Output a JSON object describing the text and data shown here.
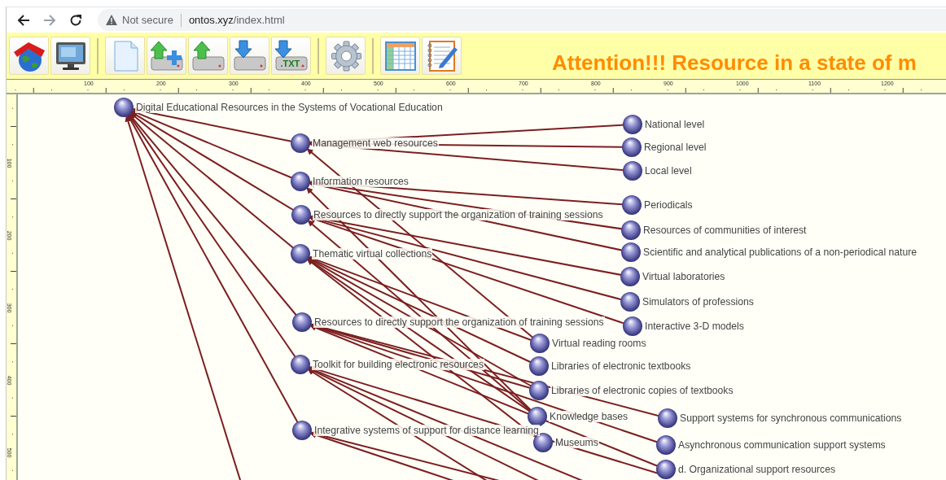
{
  "browser": {
    "back": {
      "disabled": false
    },
    "forward": {
      "disabled": true
    },
    "security": "Not secure",
    "url_host": "ontos.xyz",
    "url_path": "/index.html"
  },
  "toolbar": {
    "buttons": [
      {
        "kind": "home"
      },
      {
        "kind": "monitor"
      },
      {
        "kind": "separator"
      },
      {
        "kind": "new"
      },
      {
        "kind": "upload-add"
      },
      {
        "kind": "upload"
      },
      {
        "kind": "download"
      },
      {
        "kind": "download-text",
        "text": ".TXT"
      },
      {
        "kind": "separator"
      },
      {
        "kind": "settings"
      },
      {
        "kind": "separator"
      },
      {
        "kind": "table"
      },
      {
        "kind": "notepad"
      }
    ],
    "banner": "Attention!!! Resource in a state of m"
  },
  "ruler": {
    "top_labels": [
      "100",
      "200",
      "300",
      "400",
      "500",
      "600",
      "700",
      "800",
      "900",
      "1000",
      "1100",
      "1200"
    ],
    "left_labels": [
      "100",
      "200",
      "300",
      "400",
      "500"
    ]
  },
  "graph": {
    "root": {
      "label": "Digital Educational Resources in the Systems of Vocational Education",
      "children": [
        {
          "label": "Management web resources",
          "children": [
            {
              "label": "National level"
            },
            {
              "label": "Regional level"
            },
            {
              "label": "Local level"
            }
          ]
        },
        {
          "label": "Information resources",
          "children": [
            {
              "label": "Periodicals"
            },
            {
              "label": "Resources of communities of interest"
            },
            {
              "label": "Scientific and analytical publications of a non-periodical nature"
            }
          ]
        },
        {
          "label": "Resources to directly support the organization of training sessions",
          "children": [
            {
              "label": "Virtual laboratories"
            },
            {
              "label": "Simulators of professions"
            },
            {
              "label": "Interactive 3-D models"
            }
          ]
        },
        {
          "label": "Thematic virtual collections",
          "children": [
            {
              "label": "Virtual reading rooms"
            },
            {
              "label": "Libraries of electronic textbooks"
            },
            {
              "label": "Libraries of electronic copies of textbooks"
            },
            {
              "label": "Knowledge bases"
            },
            {
              "label": "Museums"
            }
          ]
        },
        {
          "label": "Resources to directly support the organization of training sessions",
          "children": [
            {
              "label": "Support systems for synchronous communications"
            },
            {
              "label": "Asynchronous communication support systems"
            },
            {
              "label": "d. Organizational support resources"
            }
          ]
        },
        {
          "label": "Toolkit for building electronic resources"
        },
        {
          "label": "Integrative systems of support for distance learning"
        }
      ]
    }
  }
}
